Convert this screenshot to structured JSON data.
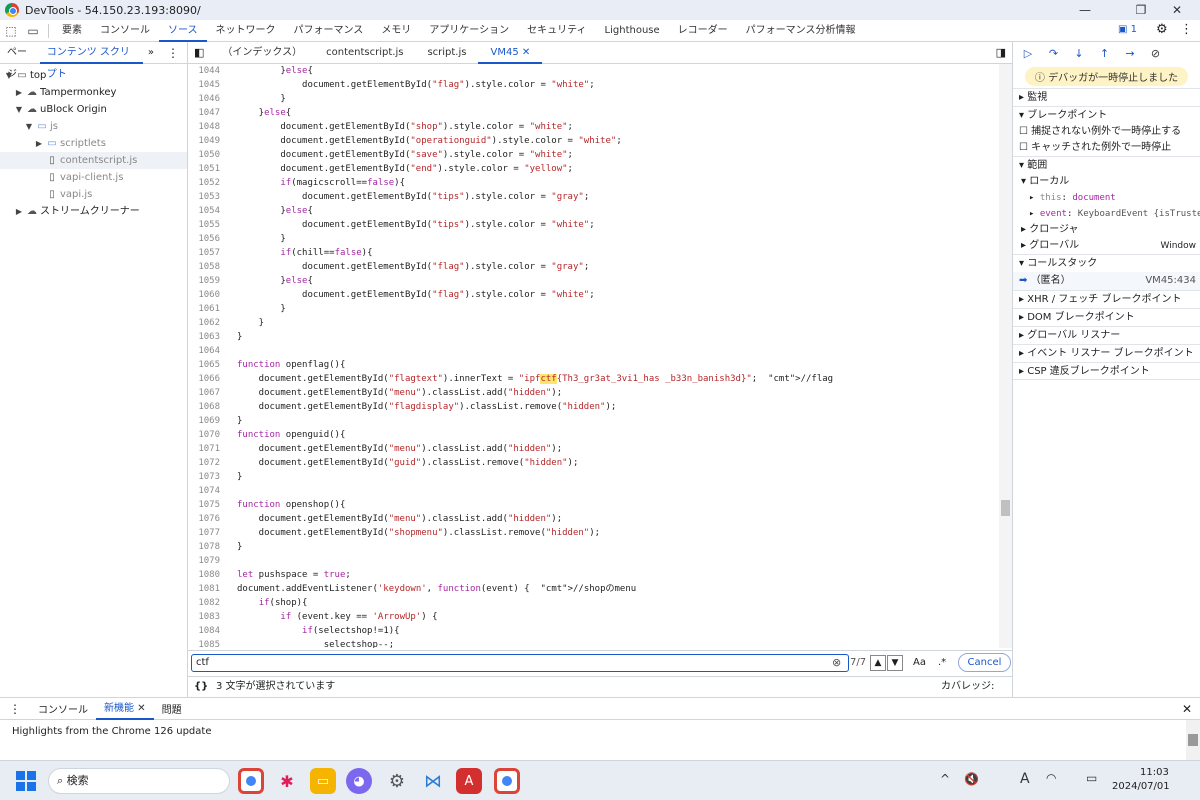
{
  "window": {
    "title": "DevTools - 54.150.23.193:8090/"
  },
  "main_tabs": [
    "要素",
    "コンソール",
    "ソース",
    "ネットワーク",
    "パフォーマンス",
    "メモリ",
    "アプリケーション",
    "セキュリティ",
    "Lighthouse",
    "レコーダー",
    "パフォーマンス分析情報"
  ],
  "issues_count": "1",
  "left_tabs": [
    "ページ",
    "コンテンツ スクリプト"
  ],
  "tree": [
    "top",
    "Tampermonkey",
    "uBlock Origin",
    "js",
    "scriptlets",
    "contentscript.js",
    "vapi-client.js",
    "vapi.js",
    "ストリームクリーナー"
  ],
  "editor_tabs": [
    "（インデックス）",
    "contentscript.js",
    "script.js",
    "VM45"
  ],
  "search": {
    "query": "ctf",
    "count": "7/7",
    "case_label": "Aa",
    "regex_label": ".*",
    "cancel": "Cancel"
  },
  "status": {
    "braces": "{}",
    "selection": "3 文字が選択されています",
    "coverage": "カバレッジ: N/A"
  },
  "code_lines": [
    [
      "1044",
      "        }else{"
    ],
    [
      "1045",
      "            document.getElementById(\"flag\").style.color = \"white\";"
    ],
    [
      "1046",
      "        }"
    ],
    [
      "1047",
      "    }else{"
    ],
    [
      "1048",
      "        document.getElementById(\"shop\").style.color = \"white\";"
    ],
    [
      "1049",
      "        document.getElementById(\"operationguid\").style.color = \"white\";"
    ],
    [
      "1050",
      "        document.getElementById(\"save\").style.color = \"white\";"
    ],
    [
      "1051",
      "        document.getElementById(\"end\").style.color = \"yellow\";"
    ],
    [
      "1052",
      "        if(magicscroll==false){"
    ],
    [
      "1053",
      "            document.getElementById(\"tips\").style.color = \"gray\";"
    ],
    [
      "1054",
      "        }else{"
    ],
    [
      "1055",
      "            document.getElementById(\"tips\").style.color = \"white\";"
    ],
    [
      "1056",
      "        }"
    ],
    [
      "1057",
      "        if(chill==false){"
    ],
    [
      "1058",
      "            document.getElementById(\"flag\").style.color = \"gray\";"
    ],
    [
      "1059",
      "        }else{"
    ],
    [
      "1060",
      "            document.getElementById(\"flag\").style.color = \"white\";"
    ],
    [
      "1061",
      "        }"
    ],
    [
      "1062",
      "    }"
    ],
    [
      "1063",
      "}"
    ],
    [
      "1064",
      ""
    ],
    [
      "1065",
      "function openflag(){"
    ],
    [
      "1066",
      "    document.getElementById(\"flagtext\").innerText = \"ipfctf{Th3_gr3at_3vi1_has _b33n_banish3d}\";  //flag"
    ],
    [
      "1067",
      "    document.getElementById(\"menu\").classList.add(\"hidden\");"
    ],
    [
      "1068",
      "    document.getElementById(\"flagdisplay\").classList.remove(\"hidden\");"
    ],
    [
      "1069",
      "}"
    ],
    [
      "1070",
      "function openguid(){"
    ],
    [
      "1071",
      "    document.getElementById(\"menu\").classList.add(\"hidden\");"
    ],
    [
      "1072",
      "    document.getElementById(\"guid\").classList.remove(\"hidden\");"
    ],
    [
      "1073",
      "}"
    ],
    [
      "1074",
      ""
    ],
    [
      "1075",
      "function openshop(){"
    ],
    [
      "1076",
      "    document.getElementById(\"menu\").classList.add(\"hidden\");"
    ],
    [
      "1077",
      "    document.getElementById(\"shopmenu\").classList.remove(\"hidden\");"
    ],
    [
      "1078",
      "}"
    ],
    [
      "1079",
      ""
    ],
    [
      "1080",
      "let pushspace = true;"
    ],
    [
      "1081",
      "document.addEventListener('keydown', function(event) {  //shopのmenu"
    ],
    [
      "1082",
      "    if(shop){"
    ],
    [
      "1083",
      "        if (event.key == 'ArrowUp') {"
    ],
    [
      "1084",
      "            if(selectshop!=1){"
    ],
    [
      "1085",
      "                selectshop--;"
    ]
  ],
  "right": {
    "paused": "デバッガが一時停止しました",
    "watch": "監視",
    "breakpoints": "ブレークポイント",
    "bp_uncaught": "捕捉されない例外で一時停止する",
    "bp_caught": "キャッチされた例外で一時停止",
    "scope": "範囲",
    "local": "ローカル",
    "this_key": "this",
    "this_val": "document",
    "event_key": "event",
    "event_val": "KeyboardEvent {isTrusted:",
    "closure": "クロージャ",
    "global": "グローバル",
    "global_val": "Window",
    "callstack": "コールスタック",
    "anon": "（匿名）",
    "anon_loc": "VM45:434",
    "xhr": "XHR / フェッチ ブレークポイント",
    "dom": "DOM ブレークポイント",
    "global_listeners": "グローバル リスナー",
    "event_listener_bp": "イベント リスナー ブレークポイント",
    "csp": "CSP 違反ブレークポイント"
  },
  "drawer": {
    "tabs": [
      "コンソール",
      "新機能",
      "問題"
    ],
    "content": "Highlights from the Chrome 126 update"
  },
  "taskbar": {
    "search": "検索",
    "time": "11:03",
    "date": "2024/07/01"
  }
}
